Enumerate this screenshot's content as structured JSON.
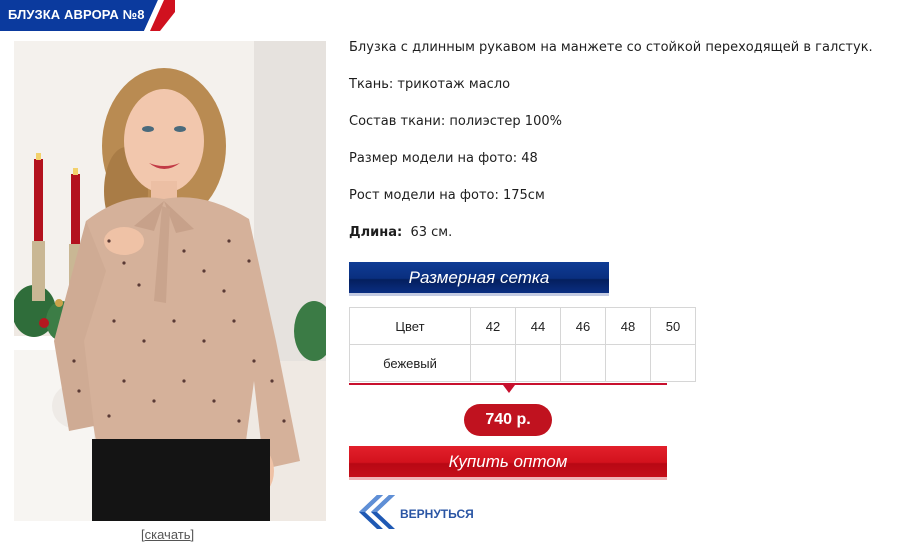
{
  "header": {
    "title": "БЛУЗКА АВРОРА №8"
  },
  "photo": {
    "download_link": "скачать",
    "download_open": "[",
    "download_close": "]"
  },
  "description": {
    "line1": "Блузка с длинным рукавом на манжете со стойкой переходящей в галстук.",
    "line2": "Ткань: трикотаж масло",
    "line3": "Состав ткани: полиэстер 100%",
    "line4": "Размер модели на фото: 48",
    "line5": "Рост модели на фото: 175см",
    "length_label": "Длина:",
    "length_value": "63 см."
  },
  "size_chart": {
    "banner": "Размерная сетка",
    "header_label": "Цвет",
    "sizes": [
      "42",
      "44",
      "46",
      "48",
      "50"
    ],
    "rows": [
      {
        "color": "бежевый"
      }
    ]
  },
  "price": "740 р.",
  "buy_button": "Купить оптом",
  "back_link": "ВЕРНУТЬСЯ",
  "colors": {
    "brand_blue": "#0a2f7f",
    "accent_red": "#c8102e",
    "link_blue": "#2a55a4"
  }
}
